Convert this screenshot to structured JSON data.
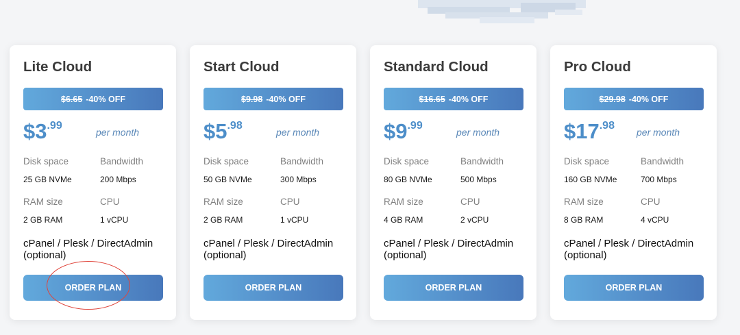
{
  "plans": [
    {
      "title": "Lite Cloud",
      "old_price": "$6.65",
      "discount": "-40% OFF",
      "price_whole": "$3",
      "price_cents": ".99",
      "period": "per month",
      "disk_label": "Disk space",
      "disk_value": "25 GB NVMe",
      "bandwidth_label": "Bandwidth",
      "bandwidth_value": "200 Mbps",
      "ram_label": "RAM size",
      "ram_value": "2 GB RAM",
      "cpu_label": "CPU",
      "cpu_value": "1 vCPU",
      "panel": "cPanel / Plesk / DirectAdmin (optional)",
      "button": "ORDER PLAN"
    },
    {
      "title": "Start Cloud",
      "old_price": "$9.98",
      "discount": "-40% OFF",
      "price_whole": "$5",
      "price_cents": ".98",
      "period": "per month",
      "disk_label": "Disk space",
      "disk_value": "50 GB NVMe",
      "bandwidth_label": "Bandwidth",
      "bandwidth_value": "300 Mbps",
      "ram_label": "RAM size",
      "ram_value": "2 GB RAM",
      "cpu_label": "CPU",
      "cpu_value": "1 vCPU",
      "panel": "cPanel / Plesk / DirectAdmin (optional)",
      "button": "ORDER PLAN"
    },
    {
      "title": "Standard Cloud",
      "old_price": "$16.65",
      "discount": "-40% OFF",
      "price_whole": "$9",
      "price_cents": ".99",
      "period": "per month",
      "disk_label": "Disk space",
      "disk_value": "80 GB NVMe",
      "bandwidth_label": "Bandwidth",
      "bandwidth_value": "500 Mbps",
      "ram_label": "RAM size",
      "ram_value": "4 GB RAM",
      "cpu_label": "CPU",
      "cpu_value": "2 vCPU",
      "panel": "cPanel / Plesk / DirectAdmin (optional)",
      "button": "ORDER PLAN"
    },
    {
      "title": "Pro Cloud",
      "old_price": "$29.98",
      "discount": "-40% OFF",
      "price_whole": "$17",
      "price_cents": ".98",
      "period": "per month",
      "disk_label": "Disk space",
      "disk_value": "160 GB NVMe",
      "bandwidth_label": "Bandwidth",
      "bandwidth_value": "700 Mbps",
      "ram_label": "RAM size",
      "ram_value": "8 GB RAM",
      "cpu_label": "CPU",
      "cpu_value": "4 vCPU",
      "panel": "cPanel / Plesk / DirectAdmin (optional)",
      "button": "ORDER PLAN"
    }
  ],
  "colors": {
    "background": "#f4f5f7",
    "card": "#ffffff",
    "gradient_start": "#62a9dc",
    "gradient_end": "#4878bb",
    "price": "#4d8ec9",
    "highlight_annotation": "#e0453b"
  },
  "decorations": {
    "top_image": "pixel-cloud",
    "annotation": "red-circle-around-order-button"
  }
}
